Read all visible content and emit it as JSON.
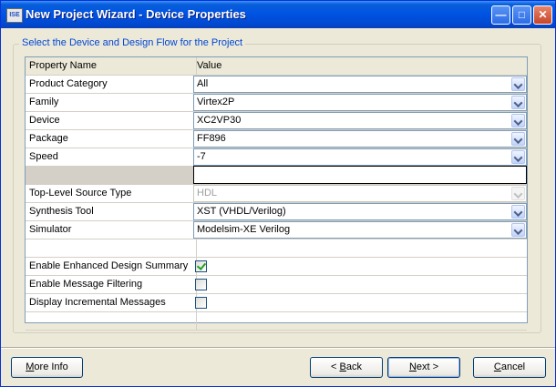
{
  "window": {
    "title": "New Project Wizard - Device Properties",
    "icon_label": "ISE"
  },
  "group": {
    "label": "Select the Device and Design Flow for the Project"
  },
  "table": {
    "headers": {
      "name": "Property Name",
      "value": "Value"
    },
    "rows": [
      {
        "name": "Product Category",
        "value": "All",
        "type": "combo"
      },
      {
        "name": "Family",
        "value": "Virtex2P",
        "type": "combo"
      },
      {
        "name": "Device",
        "value": "XC2VP30",
        "type": "combo"
      },
      {
        "name": "Package",
        "value": "FF896",
        "type": "combo"
      },
      {
        "name": "Speed",
        "value": "-7",
        "type": "combo"
      },
      {
        "name": "",
        "value": "",
        "type": "separator"
      },
      {
        "name": "Top-Level Source Type",
        "value": "HDL",
        "type": "combo-disabled"
      },
      {
        "name": "Synthesis Tool",
        "value": "XST (VHDL/Verilog)",
        "type": "combo"
      },
      {
        "name": "Simulator",
        "value": "Modelsim-XE Verilog",
        "type": "combo"
      },
      {
        "name": "",
        "value": "",
        "type": "blank"
      },
      {
        "name": "Enable Enhanced Design Summary",
        "value": "checked",
        "type": "checkbox"
      },
      {
        "name": "Enable Message Filtering",
        "value": "unchecked",
        "type": "checkbox"
      },
      {
        "name": "Display Incremental Messages",
        "value": "unchecked",
        "type": "checkbox"
      },
      {
        "name": "",
        "value": "",
        "type": "blank"
      }
    ]
  },
  "buttons": {
    "more_info": {
      "prefix": "",
      "accel": "M",
      "rest": "ore Info"
    },
    "back": {
      "prefix": "< ",
      "accel": "B",
      "rest": "ack"
    },
    "next": {
      "prefix": "",
      "accel": "N",
      "rest": "ext >"
    },
    "cancel": {
      "prefix": "",
      "accel": "C",
      "rest": "ancel"
    }
  }
}
